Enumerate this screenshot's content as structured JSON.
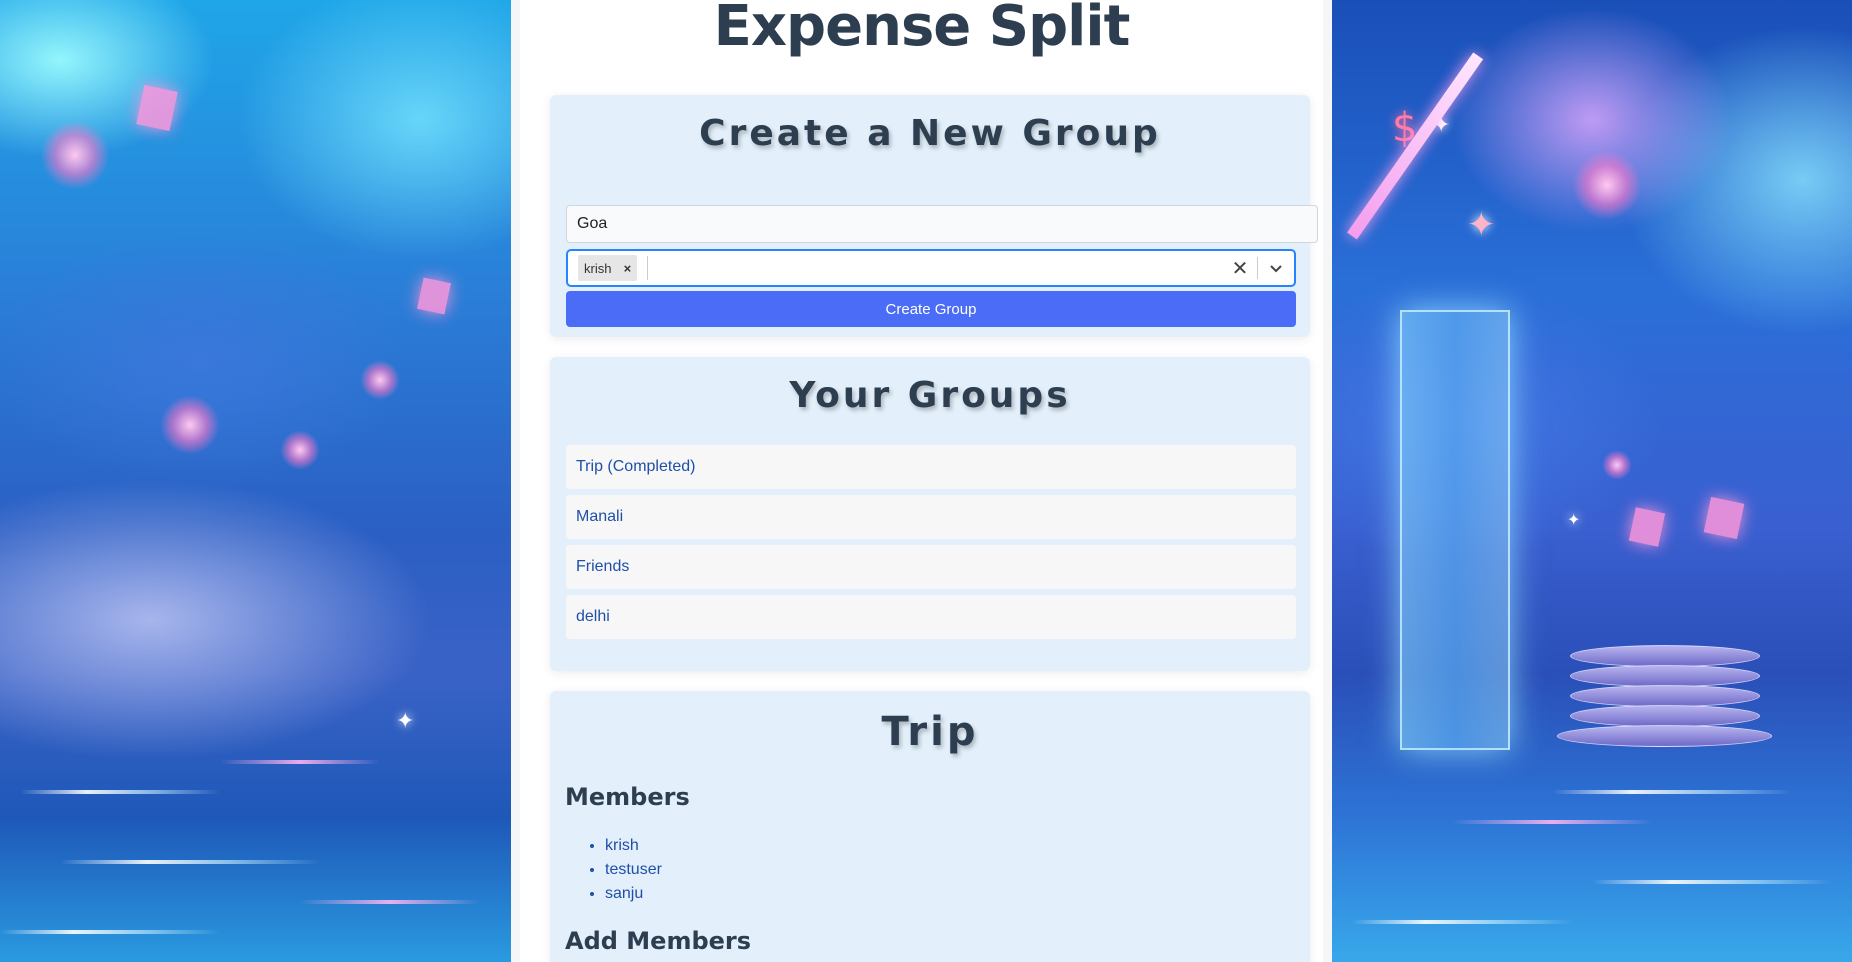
{
  "app": {
    "title": "Expense Split"
  },
  "create_group": {
    "title": "Create a New Group",
    "name_value": "Goa",
    "selected_members": [
      "krish"
    ],
    "chip_remove_symbol": "×",
    "clear_symbol": "✕",
    "button_label": "Create Group"
  },
  "your_groups": {
    "title": "Your Groups",
    "items": [
      "Trip (Completed)",
      "Manali",
      "Friends",
      "delhi"
    ]
  },
  "group_detail": {
    "title": "Trip",
    "members_heading": "Members",
    "members": [
      "krish",
      "testuser",
      "sanju"
    ],
    "add_members_heading": "Add Members"
  },
  "decor": {
    "currency_symbol": "$"
  },
  "colors": {
    "primary_button": "#4a6cf7",
    "card_bg": "#e3f0fb",
    "link_text": "#1f4fa8",
    "heading_text": "#2c3e50",
    "focus_border": "#2684ff"
  }
}
